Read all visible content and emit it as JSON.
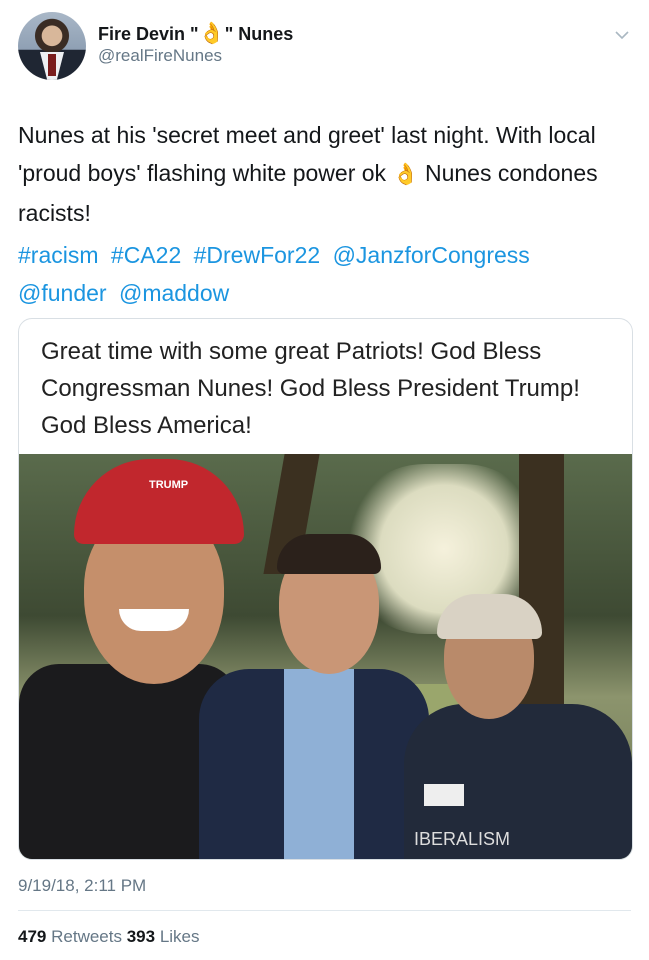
{
  "author": {
    "name_part1": "Fire Devin \"",
    "name_emoji": "👌",
    "name_part2": "\" Nunes",
    "handle": "@realFireNunes"
  },
  "tweet": {
    "text_before_emoji": "Nunes at his 'secret meet and greet' last night.  With local 'proud boys' flashing white power ok ",
    "emoji": "👌",
    "text_after_emoji": " Nunes condones racists!",
    "links": [
      "#racism",
      "#CA22",
      "#DrewFor22",
      "@JanzforCongress",
      "@funder",
      "@maddow"
    ]
  },
  "card": {
    "caption": "Great time with some great Patriots! God Bless Congressman Nunes! God Bless President Trump! God Bless America!"
  },
  "meta": {
    "timestamp": "9/19/18, 2:11 PM",
    "retweets_count": "479",
    "retweets_label": "Retweets",
    "likes_count": "393",
    "likes_label": "Likes"
  },
  "icons": {
    "menu": "chevron-down-icon"
  }
}
